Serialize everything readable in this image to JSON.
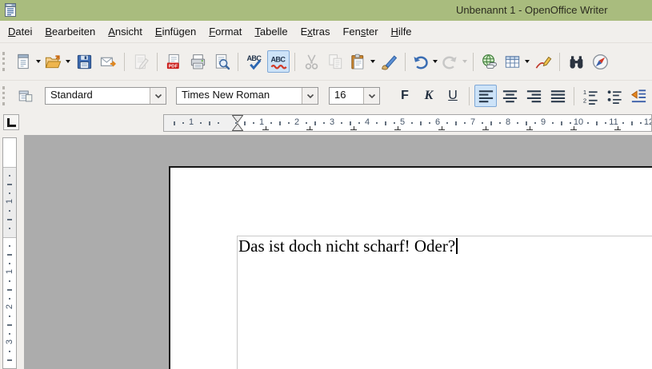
{
  "window": {
    "title": "Unbenannt 1 - OpenOffice Writer"
  },
  "colors": {
    "titlebar_green": "#a9bc7e",
    "toolbar_gray": "#f1efec",
    "canvas_gray": "#acacac",
    "active_button_blue": "#cde3f8",
    "active_button_border": "#7fa8d6"
  },
  "menubar": {
    "items": [
      {
        "label": "Datei",
        "accel": "D"
      },
      {
        "label": "Bearbeiten",
        "accel": "B"
      },
      {
        "label": "Ansicht",
        "accel": "A"
      },
      {
        "label": "Einfügen",
        "accel": "E"
      },
      {
        "label": "Format",
        "accel": "F"
      },
      {
        "label": "Tabelle",
        "accel": "T"
      },
      {
        "label": "Extras",
        "accel": "x"
      },
      {
        "label": "Fenster",
        "accel": "s"
      },
      {
        "label": "Hilfe",
        "accel": "H"
      }
    ]
  },
  "toolbar_standard": {
    "items": [
      {
        "name": "new-document",
        "icon": "new-document-icon",
        "dropdown": true
      },
      {
        "name": "open",
        "icon": "open-icon",
        "dropdown": true
      },
      {
        "name": "save",
        "icon": "save-icon"
      },
      {
        "name": "email",
        "icon": "email-icon"
      },
      {
        "type": "separator"
      },
      {
        "name": "edit-file",
        "icon": "edit-file-icon",
        "disabled": true
      },
      {
        "type": "separator"
      },
      {
        "name": "export-pdf",
        "icon": "pdf-icon"
      },
      {
        "name": "print",
        "icon": "print-icon"
      },
      {
        "name": "page-preview",
        "icon": "page-preview-icon"
      },
      {
        "type": "separator"
      },
      {
        "name": "spellcheck",
        "icon": "spellcheck-icon"
      },
      {
        "name": "auto-spellcheck",
        "icon": "auto-spellcheck-icon",
        "active": true
      },
      {
        "type": "separator"
      },
      {
        "name": "cut",
        "icon": "cut-icon",
        "disabled": true
      },
      {
        "name": "copy",
        "icon": "copy-icon",
        "disabled": true
      },
      {
        "name": "paste",
        "icon": "paste-icon",
        "dropdown": true
      },
      {
        "name": "format-paintbrush",
        "icon": "paintbrush-icon"
      },
      {
        "type": "separator"
      },
      {
        "name": "undo",
        "icon": "undo-icon",
        "dropdown": true
      },
      {
        "name": "redo",
        "icon": "redo-icon",
        "disabled": true,
        "dropdown": true
      },
      {
        "type": "separator"
      },
      {
        "name": "hyperlink",
        "icon": "hyperlink-icon"
      },
      {
        "name": "insert-table",
        "icon": "table-icon",
        "dropdown": true
      },
      {
        "name": "draw-functions",
        "icon": "draw-functions-icon"
      },
      {
        "type": "separator"
      },
      {
        "name": "find-replace",
        "icon": "find-replace-icon"
      },
      {
        "name": "navigator",
        "icon": "navigator-icon"
      }
    ]
  },
  "toolbar_formatting": {
    "paragraph_style": "Standard",
    "font_name": "Times New Roman",
    "font_size": "16",
    "text_buttons": [
      {
        "name": "bold",
        "label": "F",
        "style": "bold"
      },
      {
        "name": "italic",
        "label": "K",
        "style": "italic"
      },
      {
        "name": "underline",
        "label": "U",
        "style": "underline"
      }
    ],
    "align_buttons": [
      {
        "name": "align-left",
        "icon": "align-left-icon",
        "active": true
      },
      {
        "name": "align-center",
        "icon": "align-center-icon"
      },
      {
        "name": "align-right",
        "icon": "align-right-icon"
      },
      {
        "name": "justify",
        "icon": "justify-icon"
      }
    ],
    "list_buttons": [
      {
        "name": "numbered-list",
        "icon": "numbered-list-icon"
      },
      {
        "name": "bullet-list",
        "icon": "bullet-list-icon"
      },
      {
        "name": "decrease-indent",
        "icon": "decrease-indent-icon"
      }
    ]
  },
  "ruler": {
    "h_numbers": [
      "1",
      "2",
      "3",
      "4",
      "5",
      "6",
      "7",
      "8",
      "9",
      "10",
      "11",
      "12"
    ],
    "h_margin_number": "1",
    "v_numbers": [
      "1",
      "2",
      "3"
    ],
    "v_margin_number": "1"
  },
  "document": {
    "text": "Das ist doch nicht scharf! Oder?"
  }
}
